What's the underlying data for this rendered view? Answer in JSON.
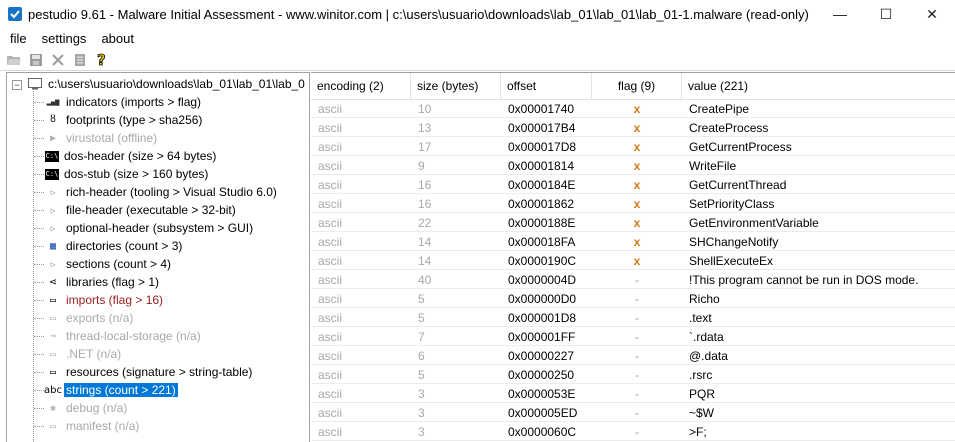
{
  "window": {
    "title": "pestudio 9.61 - Malware Initial Assessment - www.winitor.com | c:\\users\\usuario\\downloads\\lab_01\\lab_01\\lab_01-1.malware (read-only)",
    "min_glyph": "—",
    "max_glyph": "☐",
    "close_glyph": "✕"
  },
  "menu": [
    "file",
    "settings",
    "about"
  ],
  "toolbar_icons": [
    "open-folder-icon",
    "save-icon",
    "close-file-icon",
    "list-icon",
    "help-icon"
  ],
  "tree": {
    "root": "c:\\users\\usuario\\downloads\\lab_01\\lab_01\\lab_0",
    "items": [
      {
        "label": "indicators (imports > flag)",
        "icon": "bar-chart-icon",
        "glyph": "▂▄▆",
        "state": "normal"
      },
      {
        "label": "footprints (type > sha256)",
        "icon": "footprint-icon",
        "glyph": "ȣ",
        "state": "normal"
      },
      {
        "label": "virustotal (offline)",
        "icon": "play-icon",
        "glyph": "▶",
        "state": "disabled"
      },
      {
        "label": "dos-header (size > 64 bytes)",
        "icon": "console-icon",
        "glyph": "C:\\",
        "state": "normal"
      },
      {
        "label": "dos-stub (size > 160 bytes)",
        "icon": "console-icon",
        "glyph": "C:\\",
        "state": "normal"
      },
      {
        "label": "rich-header (tooling > Visual Studio 6.0)",
        "icon": "chevron-right-icon",
        "glyph": "▷",
        "state": "normal"
      },
      {
        "label": "file-header (executable > 32-bit)",
        "icon": "chevron-right-icon",
        "glyph": "▷",
        "state": "normal"
      },
      {
        "label": "optional-header (subsystem > GUI)",
        "icon": "chevron-right-icon",
        "glyph": "▷",
        "state": "normal"
      },
      {
        "label": "directories (count > 3)",
        "icon": "grid-icon",
        "glyph": "▦",
        "state": "normal"
      },
      {
        "label": "sections (count > 4)",
        "icon": "chevron-right-icon",
        "glyph": "▷",
        "state": "normal"
      },
      {
        "label": "libraries (flag > 1)",
        "icon": "share-icon",
        "glyph": "⋖",
        "state": "normal"
      },
      {
        "label": "imports (flag > 16)",
        "icon": "document-icon",
        "glyph": "▭",
        "state": "red"
      },
      {
        "label": "exports (n/a)",
        "icon": "document-icon",
        "glyph": "▭",
        "state": "disabled"
      },
      {
        "label": "thread-local-storage (n/a)",
        "icon": "key-icon",
        "glyph": "⊸",
        "state": "disabled"
      },
      {
        "label": ".NET (n/a)",
        "icon": "document-icon",
        "glyph": "▭",
        "state": "disabled"
      },
      {
        "label": "resources (signature > string-table)",
        "icon": "document-icon",
        "glyph": "▭",
        "state": "normal"
      },
      {
        "label": "strings (count > 221)",
        "icon": "abc-icon",
        "glyph": "abc",
        "state": "selected"
      },
      {
        "label": "debug (n/a)",
        "icon": "bug-icon",
        "glyph": "✱",
        "state": "disabled"
      },
      {
        "label": "manifest (n/a)",
        "icon": "document-icon",
        "glyph": "▭",
        "state": "disabled"
      }
    ]
  },
  "table": {
    "columns": [
      "encoding (2)",
      "size (bytes)",
      "offset",
      "flag (9)",
      "value (221)"
    ],
    "rows": [
      [
        "ascii",
        "10",
        "0x00001740",
        "x",
        "CreatePipe"
      ],
      [
        "ascii",
        "13",
        "0x000017B4",
        "x",
        "CreateProcess"
      ],
      [
        "ascii",
        "17",
        "0x000017D8",
        "x",
        "GetCurrentProcess"
      ],
      [
        "ascii",
        "9",
        "0x00001814",
        "x",
        "WriteFile"
      ],
      [
        "ascii",
        "16",
        "0x0000184E",
        "x",
        "GetCurrentThread"
      ],
      [
        "ascii",
        "16",
        "0x00001862",
        "x",
        "SetPriorityClass"
      ],
      [
        "ascii",
        "22",
        "0x0000188E",
        "x",
        "GetEnvironmentVariable"
      ],
      [
        "ascii",
        "14",
        "0x000018FA",
        "x",
        "SHChangeNotify"
      ],
      [
        "ascii",
        "14",
        "0x0000190C",
        "x",
        "ShellExecuteEx"
      ],
      [
        "ascii",
        "40",
        "0x0000004D",
        "-",
        "!This program cannot be run in DOS mode."
      ],
      [
        "ascii",
        "5",
        "0x000000D0",
        "-",
        "Richo"
      ],
      [
        "ascii",
        "5",
        "0x000001D8",
        "-",
        ".text"
      ],
      [
        "ascii",
        "7",
        "0x000001FF",
        "-",
        "`.rdata"
      ],
      [
        "ascii",
        "6",
        "0x00000227",
        "-",
        "@.data"
      ],
      [
        "ascii",
        "5",
        "0x00000250",
        "-",
        ".rsrc"
      ],
      [
        "ascii",
        "3",
        "0x0000053E",
        "-",
        "PQR"
      ],
      [
        "ascii",
        "3",
        "0x000005ED",
        "-",
        "~$W"
      ],
      [
        "ascii",
        "3",
        "0x0000060C",
        "-",
        ">F;"
      ]
    ]
  },
  "colors": {
    "selection": "#0078d7",
    "flag_x": "#d2791a",
    "disabled_text": "#a9a9a9",
    "red_text": "#9b1b1b"
  }
}
